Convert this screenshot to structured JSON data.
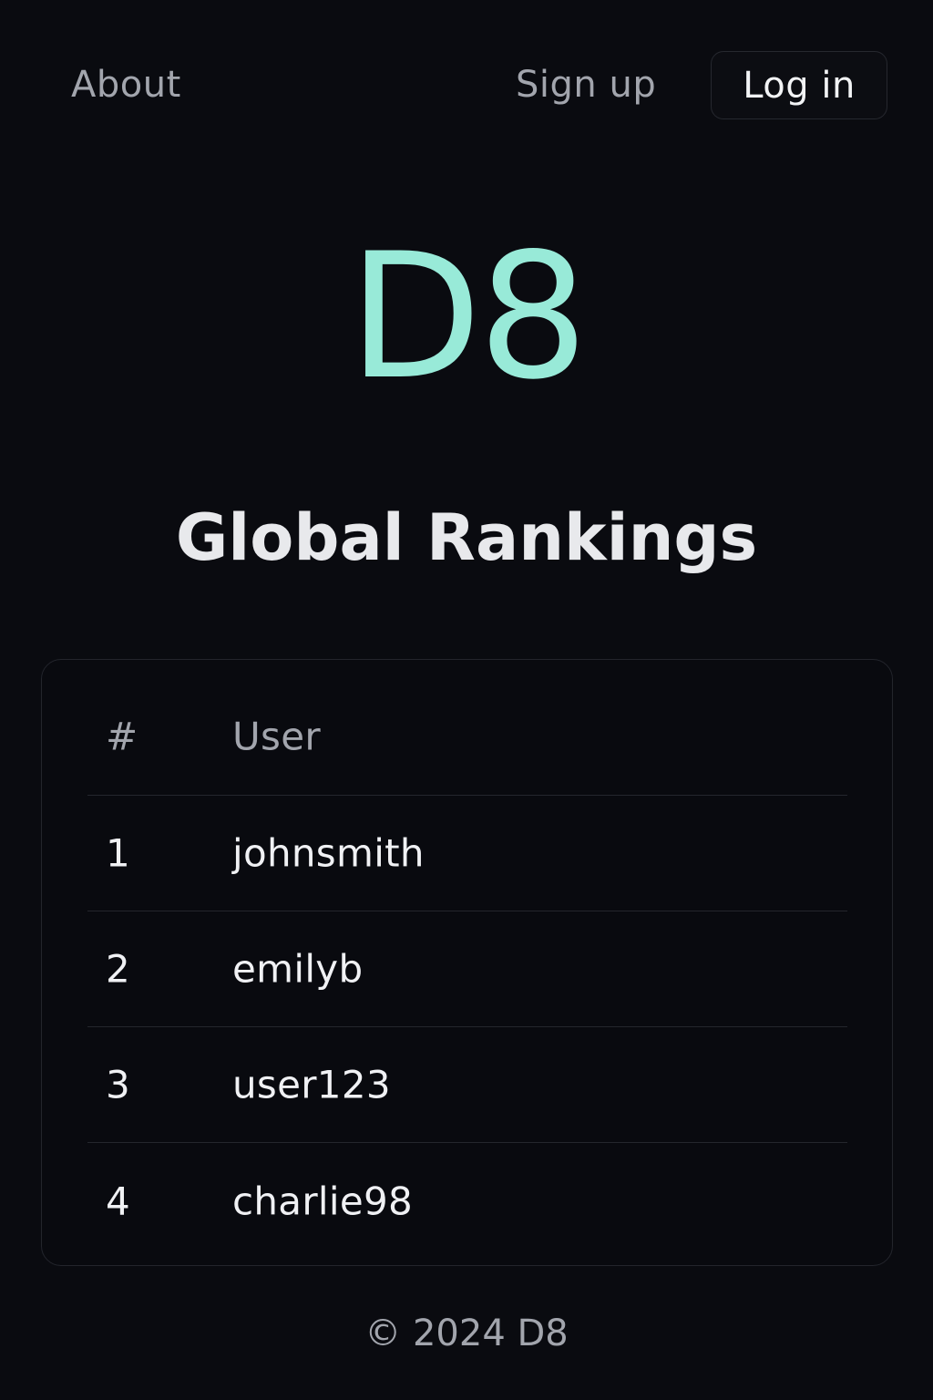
{
  "nav": {
    "about_label": "About",
    "signup_label": "Sign up",
    "login_label": "Log in"
  },
  "brand": {
    "logo_text": "D8",
    "accent_color": "#98ead8"
  },
  "page": {
    "title": "Global Rankings"
  },
  "rankings": {
    "columns": [
      "#",
      "User"
    ],
    "rows": [
      {
        "rank": "1",
        "user": "johnsmith"
      },
      {
        "rank": "2",
        "user": "emilyb"
      },
      {
        "rank": "3",
        "user": "user123"
      },
      {
        "rank": "4",
        "user": "charlie98"
      }
    ]
  },
  "footer": {
    "text": "© 2024 D8"
  }
}
